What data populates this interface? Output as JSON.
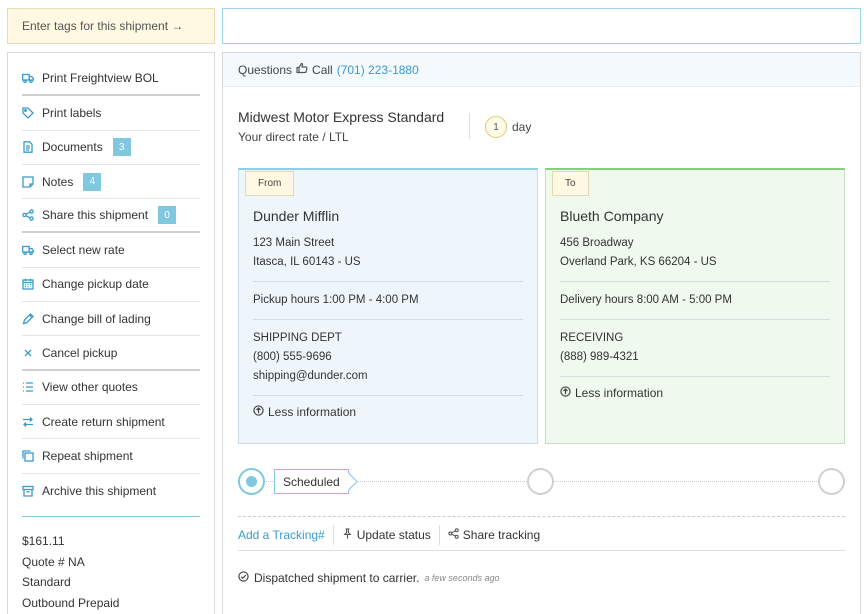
{
  "tags": {
    "button_label": "Enter tags for this shipment →",
    "input_value": ""
  },
  "sidebar": {
    "items": [
      {
        "label": "Print Freightview BOL",
        "icon": "truck-icon",
        "badge": ""
      },
      {
        "label": "Print labels",
        "icon": "tag-icon",
        "badge": ""
      },
      {
        "label": "Documents",
        "icon": "document-icon",
        "badge": "3"
      },
      {
        "label": "Notes",
        "icon": "note-icon",
        "badge": "4"
      },
      {
        "label": "Share this shipment",
        "icon": "share-icon",
        "badge": "0"
      },
      {
        "label": "Select new rate",
        "icon": "truck-icon",
        "badge": ""
      },
      {
        "label": "Change pickup date",
        "icon": "calendar-icon",
        "badge": ""
      },
      {
        "label": "Change bill of lading",
        "icon": "pencil-icon",
        "badge": ""
      },
      {
        "label": "Cancel pickup",
        "icon": "close-icon",
        "badge": ""
      },
      {
        "label": "View other quotes",
        "icon": "list-icon",
        "badge": ""
      },
      {
        "label": "Create return shipment",
        "icon": "swap-icon",
        "badge": ""
      },
      {
        "label": "Repeat shipment",
        "icon": "copy-icon",
        "badge": ""
      },
      {
        "label": "Archive this shipment",
        "icon": "archive-icon",
        "badge": ""
      }
    ],
    "quote": {
      "price": "$161.11",
      "quote_number": "Quote # NA",
      "service": "Standard",
      "payment": "Outbound Prepaid"
    }
  },
  "questions": {
    "label": "Questions",
    "call_label": "Call",
    "phone": "(701) 223-1880"
  },
  "carrier": {
    "name": "Midwest Motor Express Standard",
    "subtitle": "Your direct rate / LTL",
    "days": "1",
    "days_label": "day"
  },
  "from": {
    "tag": "From",
    "company": "Dunder Mifflin",
    "address1": "123 Main Street",
    "address2": "Itasca, IL 60143 - US",
    "hours": "Pickup hours 1:00 PM - 4:00 PM",
    "contact": "SHIPPING DEPT",
    "phone": "(800) 555-9696",
    "email": "shipping@dunder.com",
    "less": "Less information"
  },
  "to": {
    "tag": "To",
    "company": "Blueth Company",
    "address1": "456 Broadway",
    "address2": "Overland Park, KS 66204 - US",
    "hours": "Delivery hours 8:00 AM - 5:00 PM",
    "contact": "RECEIVING",
    "phone": "(888) 989-4321",
    "less": "Less information"
  },
  "tracking": {
    "status": "Scheduled",
    "add_tracking": "Add a Tracking#",
    "update_status": "Update status",
    "share_tracking": "Share tracking",
    "event_text": "Dispatched shipment to carrier.",
    "event_time": "a few seconds ago"
  },
  "colors": {
    "accent": "#3a9bcf",
    "badge": "#7fc8e0",
    "from_bg": "#eef6fc",
    "to_bg": "#eff9ee",
    "tag_bg": "#fff9e3"
  }
}
